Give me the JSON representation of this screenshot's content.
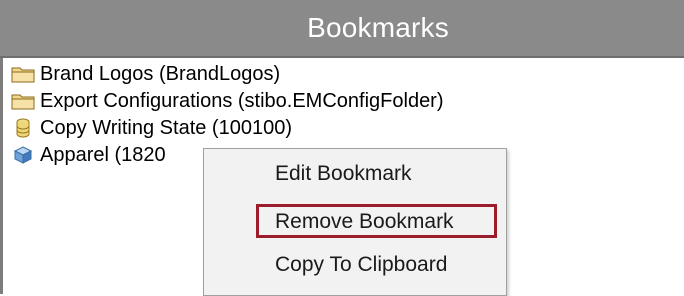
{
  "panel": {
    "title": "Bookmarks"
  },
  "bookmarks": [
    {
      "icon": "folder-icon",
      "label": "Brand Logos (BrandLogos)"
    },
    {
      "icon": "folder-icon",
      "label": "Export Configurations (stibo.EMConfigFolder)"
    },
    {
      "icon": "database-icon",
      "label": "Copy Writing State (100100)"
    },
    {
      "icon": "cube-icon",
      "label": "Apparel (1820"
    }
  ],
  "context_menu": {
    "items": [
      {
        "label": "Edit Bookmark"
      },
      {
        "label": "Remove Bookmark",
        "highlighted": true
      },
      {
        "label": "Copy To Clipboard"
      }
    ],
    "highlight_color": "#9b1c2b"
  },
  "colors": {
    "header_bg": "#8a8a8a",
    "header_text": "#ffffff",
    "menu_bg": "#f2f2f2"
  }
}
